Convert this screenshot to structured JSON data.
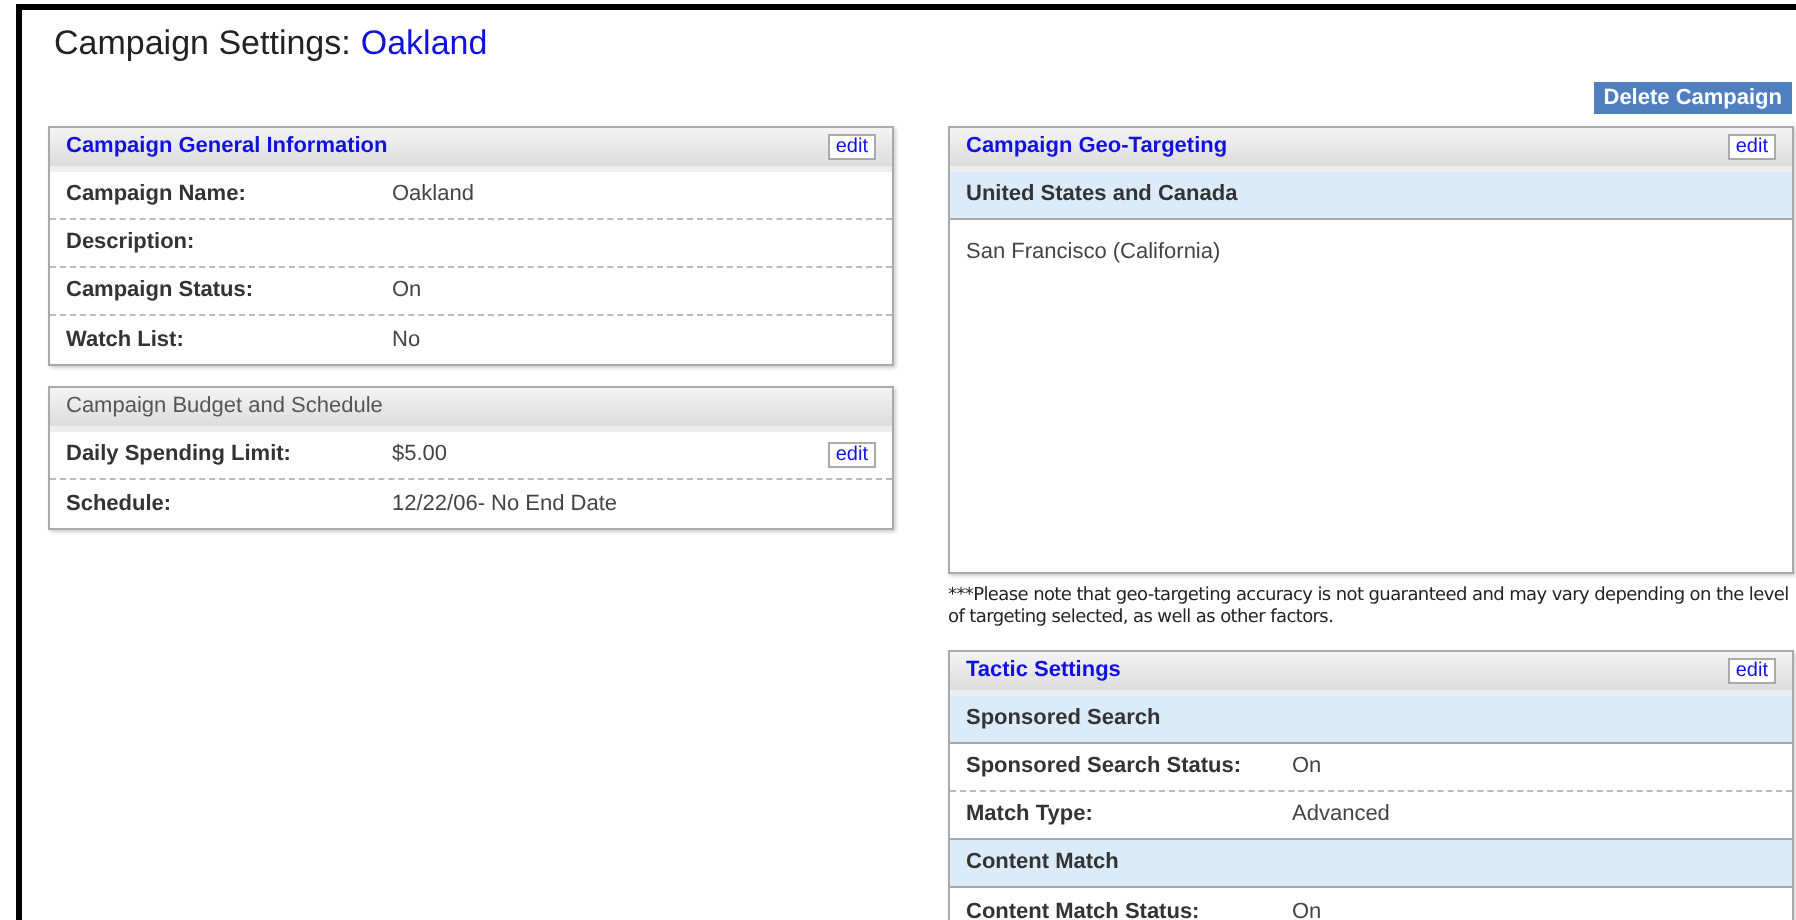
{
  "page_title": {
    "label": "Campaign Settings:",
    "campaign": "Oakland"
  },
  "delete_button": "Delete Campaign",
  "left_panels": [
    {
      "title": "Campaign General Information",
      "title_link": true,
      "edit": "edit",
      "rows": [
        {
          "kind": "field",
          "label": "Campaign Name:",
          "value": "Oakland"
        },
        {
          "kind": "field",
          "label": "Description:"
        },
        {
          "kind": "field",
          "label": "Campaign Status:",
          "value": "On"
        },
        {
          "kind": "field",
          "label": "Watch List:",
          "value": "No"
        }
      ]
    },
    {
      "title": "Campaign Budget and Schedule",
      "title_link": false,
      "rows": [
        {
          "kind": "field",
          "label": "Daily Spending Limit:",
          "value": "$5.00",
          "edit": "edit"
        },
        {
          "kind": "field",
          "label": "Schedule:",
          "value": "12/22/06- No End Date"
        }
      ]
    }
  ],
  "right_panels": [
    {
      "title": "Campaign Geo-Targeting",
      "title_link": true,
      "edit": "edit",
      "rows": [
        {
          "kind": "section",
          "label": "United States and Canada"
        },
        {
          "kind": "text",
          "label": "San Francisco (California)"
        }
      ],
      "note": "***Please note that geo-targeting accuracy is not guaranteed and may vary depending on the level of targeting selected, as well as other factors."
    },
    {
      "title": "Tactic Settings",
      "title_link": true,
      "edit": "edit",
      "rows": [
        {
          "kind": "section",
          "label": "Sponsored Search"
        },
        {
          "kind": "field",
          "label": "Sponsored Search Status:",
          "value": "On"
        },
        {
          "kind": "field",
          "label": "Match Type:",
          "value": "Advanced"
        },
        {
          "kind": "section",
          "label": "Content Match"
        },
        {
          "kind": "field",
          "label": "Content Match Status:",
          "value": "On"
        }
      ]
    }
  ]
}
